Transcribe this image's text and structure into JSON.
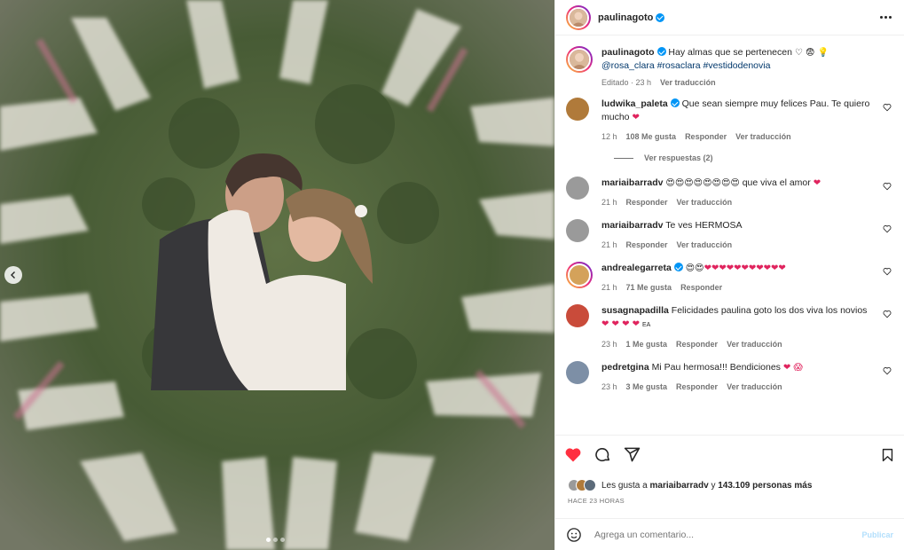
{
  "post": {
    "author": "paulinagoto",
    "verified": true,
    "caption": {
      "text": "Hay almas que se pertenecen",
      "emojis": "♡ 😨 💡",
      "tags": "@rosa_clara #rosaclara #vestidodenovia",
      "edited": "Editado · 23 h",
      "translate": "Ver traducción"
    },
    "likes_prefix": "Les gusta a",
    "likes_user": "mariaibarradv",
    "likes_mid": "y",
    "likes_count": "143.109 personas más",
    "date": "HACE 23 HORAS",
    "comment_placeholder": "Agrega un comentario...",
    "publish_label": "Publicar",
    "carousel_active": 0,
    "carousel_count": 3
  },
  "comments": [
    {
      "user": "ludwika_paleta",
      "verified": true,
      "text": "Que sean siempre muy felices Pau. Te quiero mucho",
      "emoji": "❤",
      "time": "12 h",
      "likes": "108 Me gusta",
      "reply": "Responder",
      "translate": "Ver traducción",
      "replies": "Ver respuestas (2)",
      "avatar_color": "#b07a3a"
    },
    {
      "user": "mariaibarradv",
      "verified": false,
      "text": "que viva el amor",
      "emoji_pre": "😍😍😍😍😍😍😍😍",
      "emoji": "❤",
      "time": "21 h",
      "reply": "Responder",
      "translate": "Ver traducción",
      "avatar_color": "#9a9a9a"
    },
    {
      "user": "mariaibarradv",
      "verified": false,
      "text": "Te ves HERMOSA",
      "time": "21 h",
      "reply": "Responder",
      "translate": "Ver traducción",
      "avatar_color": "#9a9a9a"
    },
    {
      "user": "andrealegarreta",
      "verified": true,
      "emoji_pre": "😍😍",
      "emoji": "❤❤❤❤❤❤❤❤❤❤❤",
      "time": "21 h",
      "likes": "71 Me gusta",
      "reply": "Responder",
      "avatar_color": "#d4a25a"
    },
    {
      "user": "susagnapadilla",
      "verified": false,
      "text": "Felicidades",
      "text2": "paulina goto los dos viva los novios",
      "emoji": "❤ ❤ ❤ ❤",
      "suffix": "EA",
      "time": "23 h",
      "likes": "1 Me gusta",
      "reply": "Responder",
      "translate": "Ver traducción",
      "avatar_color": "#c94b3a"
    },
    {
      "user": "pedretgina",
      "verified": false,
      "text": "Mi Pau hermosa!!! Bendiciones",
      "emoji": "❤ 😱",
      "time": "23 h",
      "likes": "3 Me gusta",
      "reply": "Responder",
      "translate": "Ver traducción",
      "avatar_color": "#7d8fa6"
    }
  ],
  "colors": {
    "accent": "#0095f6",
    "like_red": "#ff3040",
    "muted": "#737373"
  },
  "icons": [
    "chevron-left-icon",
    "more-icon",
    "heart-icon",
    "comment-icon",
    "share-icon",
    "bookmark-icon",
    "emoji-icon",
    "verified-icon"
  ]
}
